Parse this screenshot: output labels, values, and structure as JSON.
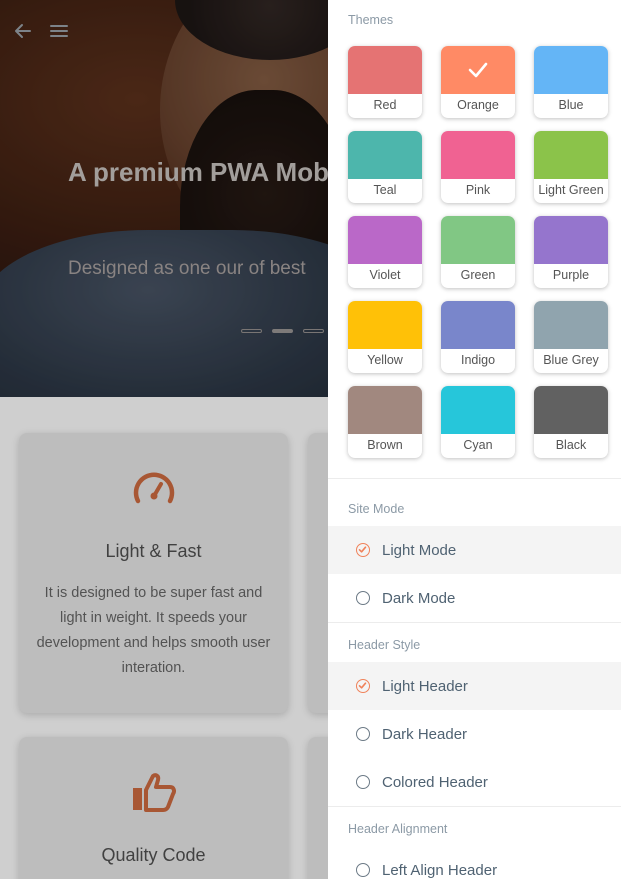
{
  "hero": {
    "title": "A premium PWA Mobile template!",
    "subtitle": "Designed as one our of best"
  },
  "features": [
    {
      "title": "Light & Fast",
      "text": "It is designed to be super fast and light in weight. It speeds your development and helps smooth user interation.",
      "icon": "speedometer-icon"
    },
    {
      "title": "Quality Code",
      "icon": "thumbs-up-icon"
    }
  ],
  "accent": "#e06a3c",
  "drawer": {
    "themes_label": "Themes",
    "themes": [
      {
        "name": "Red",
        "color": "#e57373"
      },
      {
        "name": "Orange",
        "color": "#ff8a65",
        "selected": true
      },
      {
        "name": "Blue",
        "color": "#64b5f6"
      },
      {
        "name": "Teal",
        "color": "#4db6ac"
      },
      {
        "name": "Pink",
        "color": "#f06292"
      },
      {
        "name": "Light Green",
        "color": "#8bc34a"
      },
      {
        "name": "Violet",
        "color": "#ba68c8"
      },
      {
        "name": "Green",
        "color": "#81c784"
      },
      {
        "name": "Purple",
        "color": "#9575cd"
      },
      {
        "name": "Yellow",
        "color": "#ffc107"
      },
      {
        "name": "Indigo",
        "color": "#7986cb"
      },
      {
        "name": "Blue Grey",
        "color": "#90a4ae"
      },
      {
        "name": "Brown",
        "color": "#a1887f"
      },
      {
        "name": "Cyan",
        "color": "#26c6da"
      },
      {
        "name": "Black",
        "color": "#616161"
      }
    ],
    "site_mode_label": "Site Mode",
    "site_modes": [
      {
        "label": "Light Mode",
        "selected": true
      },
      {
        "label": "Dark Mode",
        "selected": false
      }
    ],
    "header_style_label": "Header Style",
    "header_styles": [
      {
        "label": "Light Header",
        "selected": true
      },
      {
        "label": "Dark Header",
        "selected": false
      },
      {
        "label": "Colored Header",
        "selected": false
      }
    ],
    "header_alignment_label": "Header Alignment",
    "header_alignments": [
      {
        "label": "Left Align Header",
        "selected": false
      }
    ]
  }
}
